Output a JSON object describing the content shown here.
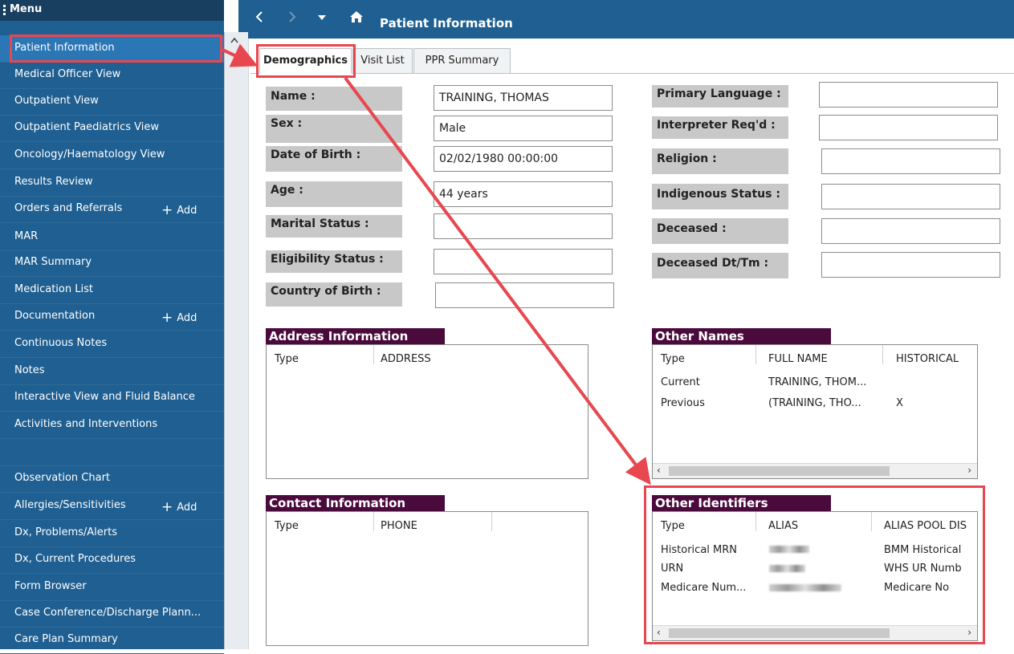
{
  "sidebar": {
    "header": "Menu",
    "items": [
      {
        "label": "Patient Information",
        "add": ""
      },
      {
        "label": "Medical Officer View",
        "add": ""
      },
      {
        "label": "Outpatient View",
        "add": ""
      },
      {
        "label": "Outpatient Paediatrics View",
        "add": ""
      },
      {
        "label": "Oncology/Haematology View",
        "add": ""
      },
      {
        "label": "Results Review",
        "add": ""
      },
      {
        "label": "Orders and Referrals",
        "add": "Add"
      },
      {
        "label": "MAR",
        "add": ""
      },
      {
        "label": "MAR Summary",
        "add": ""
      },
      {
        "label": "Medication List",
        "add": ""
      },
      {
        "label": "Documentation",
        "add": "Add"
      },
      {
        "label": "Continuous Notes",
        "add": ""
      },
      {
        "label": "Notes",
        "add": ""
      },
      {
        "label": "Interactive View and Fluid Balance",
        "add": ""
      },
      {
        "label": "Activities and Interventions",
        "add": ""
      },
      {
        "label": "",
        "add": ""
      },
      {
        "label": "Observation Chart",
        "add": ""
      },
      {
        "label": "Allergies/Sensitivities",
        "add": "Add"
      },
      {
        "label": "Dx, Problems/Alerts",
        "add": ""
      },
      {
        "label": "Dx, Current Procedures",
        "add": ""
      },
      {
        "label": "Form Browser",
        "add": ""
      },
      {
        "label": "Case Conference/Discharge Plann...",
        "add": ""
      },
      {
        "label": "Care Plan Summary",
        "add": ""
      }
    ]
  },
  "topbar": {
    "title": "Patient Information"
  },
  "tabs": [
    "Demographics",
    "Visit List",
    "PPR Summary"
  ],
  "demographics_left": [
    {
      "label": "Name :",
      "value": "TRAINING, THOMAS"
    },
    {
      "label": "Sex :",
      "value": "Male"
    },
    {
      "label": "Date of Birth :",
      "value": "02/02/1980 00:00:00"
    },
    {
      "label": "Age :",
      "value": "44 years"
    },
    {
      "label": "Marital Status :",
      "value": ""
    },
    {
      "label": "Eligibility Status :",
      "value": ""
    },
    {
      "label": "Country of Birth :",
      "value": ""
    }
  ],
  "demographics_right": [
    {
      "label": "Primary Language :",
      "value": ""
    },
    {
      "label": "Interpreter Req'd :",
      "value": ""
    },
    {
      "label": "Religion :",
      "value": ""
    },
    {
      "label": "Indigenous Status :",
      "value": ""
    },
    {
      "label": "Deceased :",
      "value": ""
    },
    {
      "label": "Deceased Dt/Tm :",
      "value": ""
    }
  ],
  "address": {
    "title": "Address Information",
    "columns": [
      "Type",
      "ADDRESS"
    ]
  },
  "contact": {
    "title": "Contact Information",
    "columns": [
      "Type",
      "PHONE"
    ]
  },
  "other_names": {
    "title": "Other Names",
    "columns": [
      "Type",
      "FULL NAME",
      "HISTORICAL"
    ],
    "rows": [
      [
        "Current",
        "TRAINING, THOM...",
        ""
      ],
      [
        "Previous",
        "(TRAINING, THO...",
        "X"
      ]
    ]
  },
  "other_identifiers": {
    "title": "Other Identifiers",
    "columns": [
      "Type",
      "ALIAS",
      "ALIAS POOL DIS"
    ],
    "rows": [
      [
        "Historical MRN",
        "",
        "BMM Historical"
      ],
      [
        "URN",
        "",
        "WHS UR Numb"
      ],
      [
        "Medicare Num...",
        "",
        "Medicare No"
      ]
    ]
  },
  "colors": {
    "sidebar": "#1f5f91",
    "header": "#183f60",
    "group_title": "#4b0a3c",
    "highlight": "#e8474f",
    "label_bg": "#c8c8c8"
  }
}
